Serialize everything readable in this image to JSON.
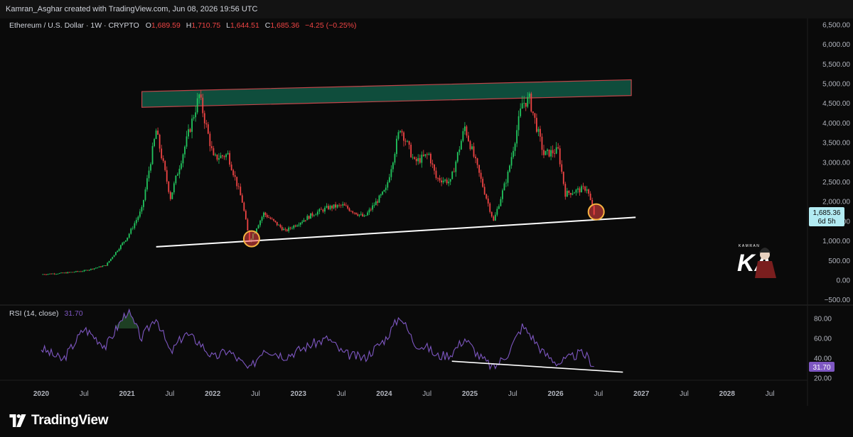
{
  "header": {
    "credit": "Kamran_Asghar created with TradingView.com, Jun 08, 2026 19:56 UTC"
  },
  "legend": {
    "symbol": "Ethereum / U.S. Dollar · 1W · CRYPTO",
    "o_label": "O",
    "o_value": "1,689.59",
    "h_label": "H",
    "h_value": "1,710.75",
    "l_label": "L",
    "l_value": "1,644.51",
    "c_label": "C",
    "c_value": "1,685.36",
    "change": "−4.25 (−0.25%)"
  },
  "price_badge": {
    "price": "1,685.36",
    "countdown": "6d 5h"
  },
  "rsi": {
    "label": "RSI (14, close)",
    "value": "31.70",
    "badge": "31.70"
  },
  "watermark": {
    "brand_text": "KAMRAN"
  },
  "footer": {
    "brand": "TradingView"
  },
  "colors": {
    "up": "#22c55e",
    "down": "#ef4444",
    "rsi_line": "#7e57c2",
    "zone_fill": "#0f4d3c",
    "zone_border": "#c2454a",
    "badge_price": "#b2ebf2",
    "badge_rsi": "#7e57c2",
    "circle": "#f5b341",
    "background": "#0a0a0a"
  },
  "chart_data": [
    {
      "type": "candlestick",
      "title": "Ethereum / U.S. Dollar · 1W · CRYPTO",
      "x_ticks": [
        "2020",
        "Jul",
        "2021",
        "Jul",
        "2022",
        "Jul",
        "2023",
        "Jul",
        "2024",
        "Jul",
        "2025",
        "Jul",
        "2026",
        "Jul",
        "2027",
        "Jul",
        "2028",
        "Jul"
      ],
      "y_ticks": [
        "6,500.00",
        "6,000.00",
        "5,500.00",
        "5,000.00",
        "4,500.00",
        "4,000.00",
        "3,500.00",
        "3,000.00",
        "2,500.00",
        "2,000.00",
        "1,500.00",
        "1,000.00",
        "500.00",
        "0.00",
        "−500.00"
      ],
      "ylim": [
        -500,
        6500
      ],
      "series": [
        {
          "x": [
            "2020-01",
            "2020-04",
            "2020-07",
            "2020-10",
            "2021-01",
            "2021-03",
            "2021-05",
            "2021-07",
            "2021-09",
            "2021-11",
            "2022-01",
            "2022-03",
            "2022-05",
            "2022-06",
            "2022-08",
            "2022-11",
            "2023-03",
            "2023-05",
            "2023-07",
            "2023-10",
            "2024-01",
            "2024-03",
            "2024-05",
            "2024-07",
            "2024-08",
            "2024-10",
            "2024-12",
            "2025-02",
            "2025-04",
            "2025-06",
            "2025-08",
            "2025-09",
            "2025-11",
            "2026-01",
            "2026-02",
            "2026-04",
            "2026-05",
            "2026-06"
          ],
          "values": [
            150,
            180,
            240,
            380,
            1100,
            1800,
            3800,
            2100,
            3400,
            4700,
            3100,
            3200,
            2000,
            1000,
            1700,
            1250,
            1700,
            1850,
            1900,
            1600,
            2300,
            3900,
            3000,
            3200,
            2600,
            2500,
            3900,
            2700,
            1500,
            2700,
            4500,
            4600,
            3200,
            3300,
            2200,
            2300,
            2350,
            1685
          ]
        }
      ],
      "annotations": {
        "resistance_zone": {
          "start": [
            "2021-05",
            4400,
            4800
          ],
          "end": [
            "2026-10",
            4700,
            5100
          ]
        },
        "support_line": {
          "start": [
            "2021-06",
            850
          ],
          "end": [
            "2026-11",
            1600
          ]
        },
        "circles": [
          [
            "2022-06",
            1000
          ],
          [
            "2026-06",
            1685
          ]
        ]
      }
    },
    {
      "type": "line",
      "title": "RSI (14, close)",
      "y_ticks": [
        "80.00",
        "60.00",
        "40.00",
        "20.00"
      ],
      "ylim": [
        15,
        95
      ],
      "series": [
        {
          "x": [
            "2020-01",
            "2020-04",
            "2020-07",
            "2020-10",
            "2021-01",
            "2021-03",
            "2021-05",
            "2021-07",
            "2021-09",
            "2021-11",
            "2022-01",
            "2022-03",
            "2022-05",
            "2022-06",
            "2022-08",
            "2022-11",
            "2023-03",
            "2023-05",
            "2023-07",
            "2023-10",
            "2024-01",
            "2024-03",
            "2024-05",
            "2024-07",
            "2024-08",
            "2024-10",
            "2024-12",
            "2025-02",
            "2025-04",
            "2025-06",
            "2025-08",
            "2025-09",
            "2025-11",
            "2026-01",
            "2026-02",
            "2026-04",
            "2026-05",
            "2026-06"
          ],
          "values": [
            50,
            38,
            70,
            52,
            88,
            60,
            82,
            45,
            65,
            56,
            40,
            48,
            35,
            28,
            50,
            42,
            55,
            60,
            45,
            40,
            60,
            83,
            55,
            50,
            42,
            44,
            60,
            42,
            30,
            45,
            72,
            65,
            45,
            35,
            38,
            45,
            42,
            31.7
          ]
        }
      ],
      "annotations": {
        "divergence_line": {
          "start": [
            "2024-10",
            37
          ],
          "end": [
            "2026-12",
            26
          ]
        }
      }
    }
  ]
}
